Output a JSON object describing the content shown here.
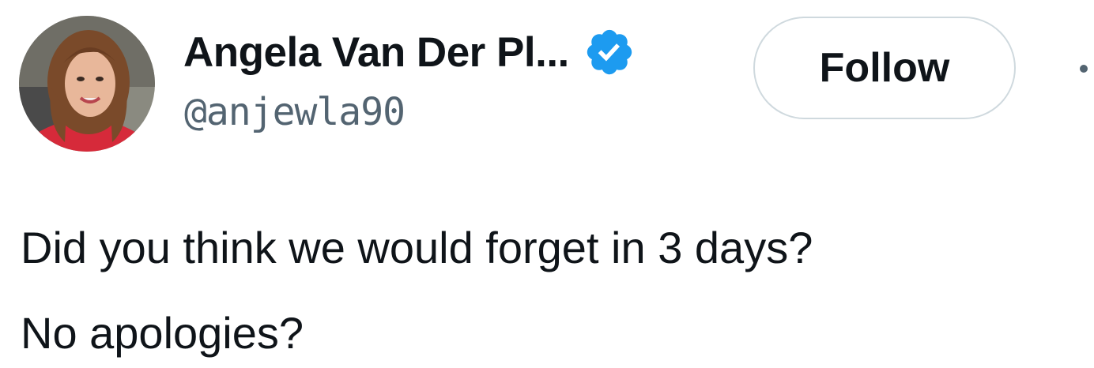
{
  "author": {
    "display_name": "Angela Van Der Pl...",
    "handle": "@anjewla90",
    "verified": true
  },
  "actions": {
    "follow_label": "Follow"
  },
  "tweet": {
    "lines": [
      "Did you think we would forget in 3 days?",
      "No apologies?"
    ]
  },
  "colors": {
    "accent": "#1d9bf0",
    "text": "#0f1419",
    "secondary_text": "#536471",
    "border": "#cfd9de"
  },
  "icons": {
    "verified": "verified-badge-icon",
    "more": "more-options-icon"
  }
}
